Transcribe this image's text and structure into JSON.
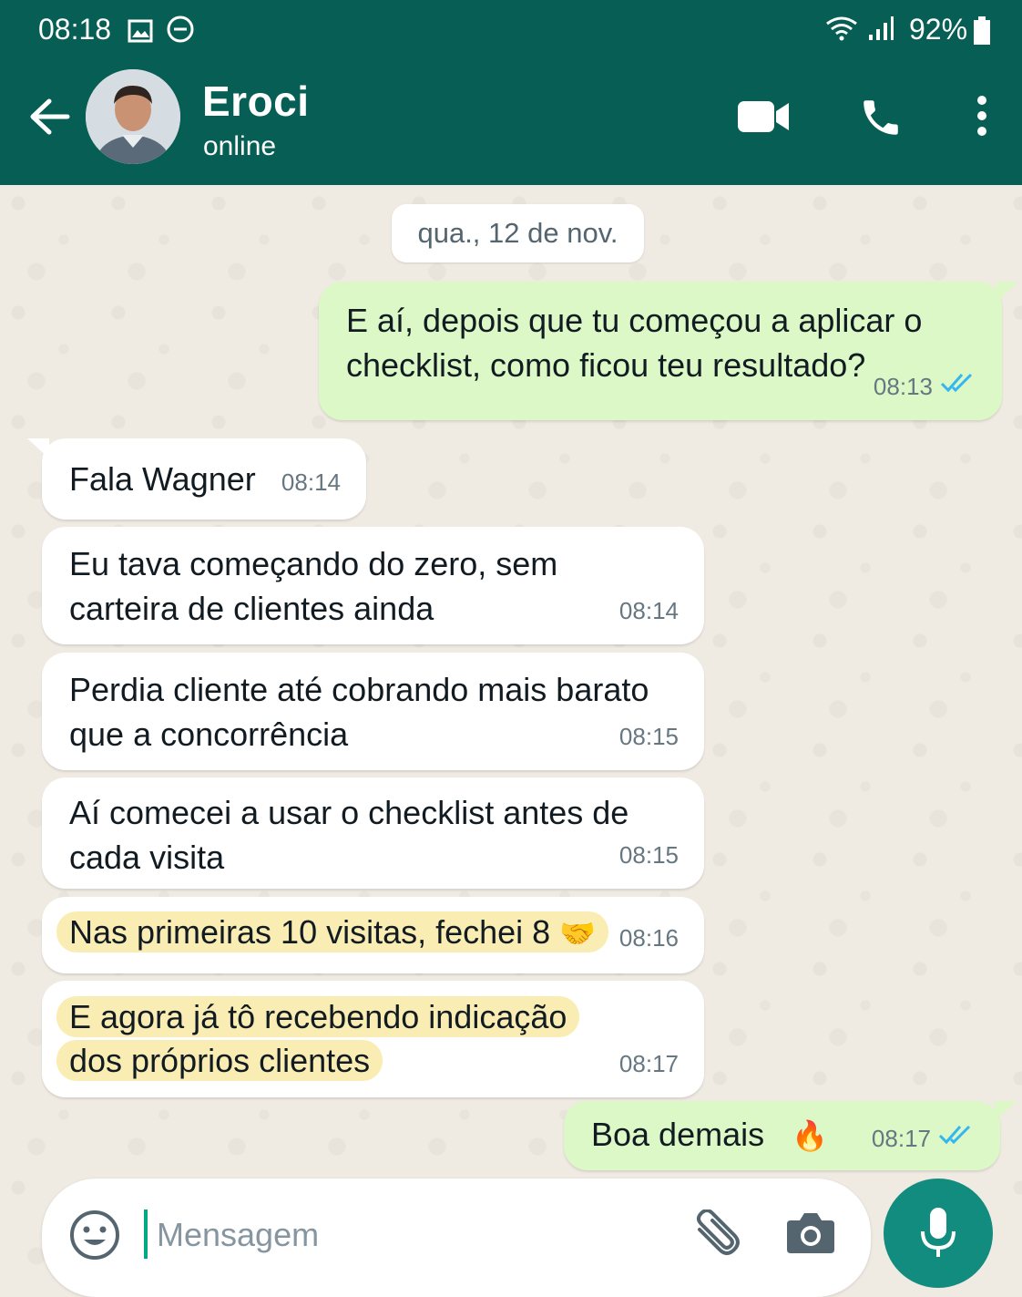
{
  "status_bar": {
    "time": "08:18",
    "battery": "92%"
  },
  "header": {
    "name": "Eroci",
    "status": "online"
  },
  "chat": {
    "date": "qua., 12 de nov.",
    "messages": [
      {
        "direction": "out",
        "text": "E aí, depois que tu começou a aplicar o checklist, como ficou teu resultado?",
        "time": "08:13",
        "read": true
      },
      {
        "direction": "in",
        "text": "Fala Wagner",
        "time": "08:14"
      },
      {
        "direction": "in",
        "text": "Eu tava começando do zero, sem carteira de clientes ainda",
        "time": "08:14"
      },
      {
        "direction": "in",
        "text": "Perdia cliente até cobrando mais barato que a concorrência",
        "time": "08:15"
      },
      {
        "direction": "in",
        "text": "Aí comecei a usar o checklist antes de cada visita",
        "time": "08:15"
      },
      {
        "direction": "in",
        "text": "Nas primeiras 10 visitas, fechei 8",
        "emoji": "🤝",
        "highlighted": true,
        "time": "08:16"
      },
      {
        "direction": "in",
        "text": "E agora já tô recebendo indicação dos próprios clientes",
        "highlighted": true,
        "time": "08:17"
      },
      {
        "direction": "out",
        "text": "Boa demais",
        "emoji": "🔥",
        "time": "08:17",
        "read": true
      }
    ]
  },
  "composer": {
    "placeholder": "Mensagem"
  },
  "icons": {
    "back": "arrow-left-icon",
    "video": "video-camera-icon",
    "call": "phone-icon",
    "menu": "more-vertical-icon",
    "emoji": "smiley-icon",
    "attach": "paperclip-icon",
    "camera": "camera-icon",
    "mic": "microphone-icon",
    "read_receipt": "double-check-icon"
  },
  "colors": {
    "header": "#075e54",
    "outgoing_bubble": "#dcf8c6",
    "incoming_bubble": "#ffffff",
    "highlight": "#faedb3",
    "read_tick": "#34b7f1",
    "mic_button": "#128c7e"
  }
}
